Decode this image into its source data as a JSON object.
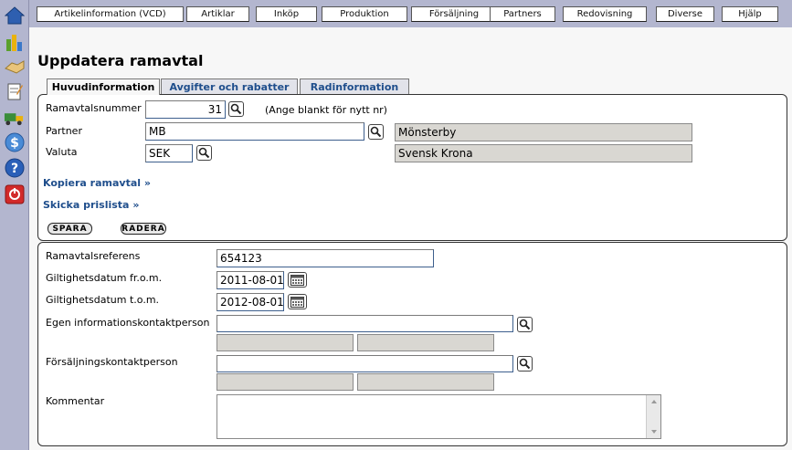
{
  "topmenu": [
    "Artikelinformation (VCD)",
    "Artiklar",
    "Inköp",
    "Produktion",
    "Försäljning",
    "Partners",
    "Redovisning",
    "Diverse",
    "Hjälp"
  ],
  "rail_icons": [
    "home-icon",
    "chart-icon",
    "handshake-icon",
    "notepad-icon",
    "truck-icon",
    "dollar-icon",
    "help-icon",
    "power-icon"
  ],
  "page_title": "Uppdatera ramavtal",
  "tabs": [
    "Huvudinformation",
    "Avgifter och rabatter",
    "Radinformation"
  ],
  "form": {
    "ramavtalsnummer_label": "Ramavtalsnummer",
    "ramavtalsnummer_value": "31",
    "ramavtalsnummer_hint": "(Ange blankt för nytt nr)",
    "partner_label": "Partner",
    "partner_value": "MB",
    "partner_name": "Mönsterby",
    "valuta_label": "Valuta",
    "valuta_value": "SEK",
    "valuta_name": "Svensk Krona"
  },
  "links": {
    "kopiera": "Kopiera ramavtal »",
    "skicka": "Skicka prislista »"
  },
  "buttons": {
    "spara": "SPARA",
    "radera": "RADERA"
  },
  "details": {
    "referens_label": "Ramavtalsreferens",
    "referens_value": "654123",
    "from_label": "Giltighetsdatum fr.o.m.",
    "from_value": "2011-08-01",
    "tom_label": "Giltighetsdatum t.o.m.",
    "tom_value": "2012-08-01",
    "egen_label": "Egen informationskontaktperson",
    "egen_value": "",
    "forsaljning_label": "Försäljningskontaktperson",
    "forsaljning_value": "",
    "kommentar_label": "Kommentar",
    "kommentar_value": ""
  },
  "colors": {
    "background": "#b3b6cf",
    "link": "#1f4e8c",
    "readonly": "#d9d7d2"
  }
}
